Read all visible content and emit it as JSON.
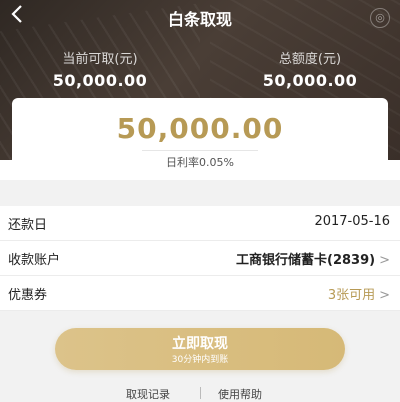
{
  "header": {
    "back_icon": "chevron-left-icon",
    "title": "白条取现",
    "corner_icon": "circle-logo-icon"
  },
  "quota": {
    "available_label": "当前可取(元)",
    "available_value": "50,000.00",
    "total_label": "总额度(元)",
    "total_value": "50,000.00"
  },
  "amount_card": {
    "amount": "50,000.00",
    "daily_rate": "日利率0.05%"
  },
  "rows": [
    {
      "label": "还款日",
      "value": "2017-05-16"
    },
    {
      "label": "收款账户",
      "value": "工商银行储蓄卡(2839)",
      "chevron": ">"
    },
    {
      "label": "优惠券",
      "value": "3张可用",
      "chevron": ">"
    }
  ],
  "button": {
    "label": "立即取现",
    "sub": "30分钟内到账"
  },
  "links": {
    "records": "取现记录",
    "help": "使用帮助"
  },
  "colors": {
    "accent": "#b79a55",
    "button": "#dcc38a"
  }
}
